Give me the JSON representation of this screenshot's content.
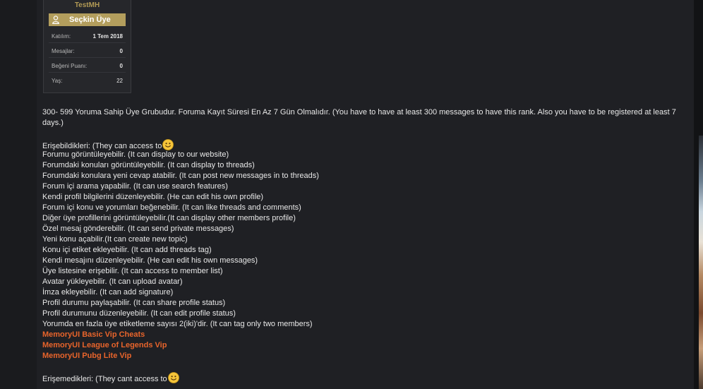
{
  "profile": {
    "username": "TestMH",
    "rank": "Seçkin Üye",
    "stats": [
      {
        "key": "Katılım:",
        "value": "1 Tem 2018"
      },
      {
        "key": "Mesajlar:",
        "value": "0"
      },
      {
        "key": "Beğeni Puanı:",
        "value": "0"
      },
      {
        "key": "Yaş:",
        "value": "22"
      }
    ]
  },
  "post": {
    "intro": "300- 599 Yoruma Sahip Üye Grubudur. Foruma Kayıt Süresi En Az 7 Gün Olmalıdır. (You have to have at least 300 messages to have this rank. Also you have to be registered at least 7 days.)",
    "permissions_heading": "Erişebildikleri: (They can access to",
    "permissions": [
      "Forumu görüntüleyebilir. (It can display to our website)",
      "Forumdaki konuları görüntüleyebilir. (It can display to threads)",
      "Forumdaki konulara yeni cevap atabilir. (It can post new messages in to threads)",
      "Forum içi arama yapabilir. (It can use search features)",
      "Kendi profil bilgilerini düzenleyebilir. (He can edit his own profile)",
      "Forum içi konu ve yorumları beğenebilir. (It can like threads and comments)",
      "Diğer üye profillerini görüntüleyebilir.(It can display other members profile)",
      "Özel mesaj gönderebilir. (It can send private messages)",
      "Yeni konu açabilir.(It can create new topic)",
      "Konu içi etiket ekleyebilir. (It can add threads tag)",
      "Kendi mesajını düzenleyebilir. (He can edit his own messages)",
      "Üye listesine erişebilir. (It can access to member list)",
      "Avatar yükleyebilir. (It can upload avatar)",
      "İmza ekleyebilir. (It can add signature)",
      "Profil durumu paylaşabilir. (It can share profile status)",
      "Profil durumunu düzenleyebilir. (It can edit profile status)",
      "Yorumda en fazla üye etiketleme sayısı 2(iki)'dir. (It can tag only two members)"
    ],
    "links": [
      "MemoryUI Basic Vip Cheats",
      "MemoryUI League of Legends Vip",
      "MemoryUI Pubg Lite Vip"
    ],
    "restrictions_heading": "Erişemedikleri: (They cant access to"
  },
  "colors": {
    "link": "#e8642b",
    "rank_banner": "#b39e5d",
    "username": "#b29a55",
    "text": "#e8e8e8"
  },
  "icons": {
    "rank": "user-icon",
    "emoji": "smiley-icon"
  }
}
